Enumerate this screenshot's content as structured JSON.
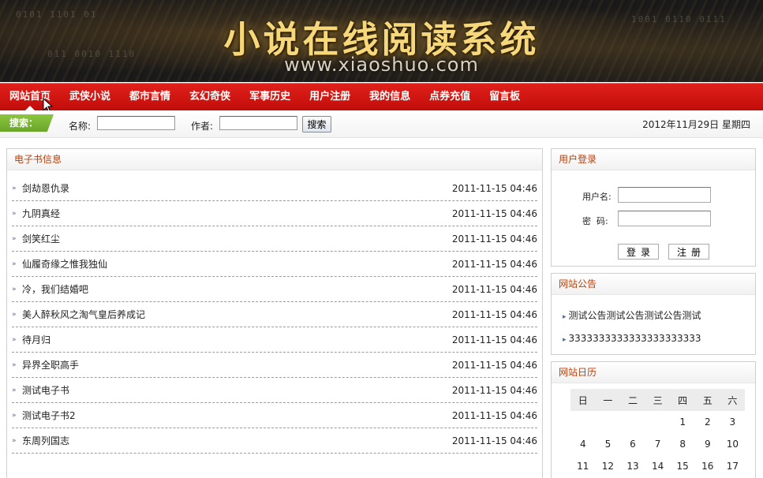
{
  "banner": {
    "title": "小说在线阅读系统",
    "url": "www.xiaoshuo.com"
  },
  "nav": {
    "items": [
      "网站首页",
      "武侠小说",
      "都市言情",
      "玄幻奇侠",
      "军事历史",
      "用户注册",
      "我的信息",
      "点券充值",
      "留言板"
    ],
    "active_index": 0
  },
  "search": {
    "tag": "搜索：",
    "name_label": "名称:",
    "name_value": "",
    "author_label": "作者:",
    "author_value": "",
    "button": "搜索"
  },
  "date": "2012年11月29日 星期四",
  "ebooks": {
    "title": "电子书信息",
    "items": [
      {
        "name": "剑劫恩仇录",
        "time": "2011-11-15 04:46"
      },
      {
        "name": "九阴真经",
        "time": "2011-11-15 04:46"
      },
      {
        "name": "剑笑红尘",
        "time": "2011-11-15 04:46"
      },
      {
        "name": "仙履奇缘之惟我独仙",
        "time": "2011-11-15 04:46"
      },
      {
        "name": "冷，我们结婚吧",
        "time": "2011-11-15 04:46"
      },
      {
        "name": "美人醉秋风之淘气皇后养成记",
        "time": "2011-11-15 04:46"
      },
      {
        "name": "待月归",
        "time": "2011-11-15 04:46"
      },
      {
        "name": "异界全职高手",
        "time": "2011-11-15 04:46"
      },
      {
        "name": "测试电子书",
        "time": "2011-11-15 04:46"
      },
      {
        "name": "测试电子书2",
        "time": "2011-11-15 04:46"
      },
      {
        "name": "东周列国志",
        "time": "2011-11-15 04:46"
      }
    ]
  },
  "login": {
    "title": "用户登录",
    "username_label": "用户名:",
    "password_label": "密  码:",
    "login_button": "登录",
    "register_button": "注册"
  },
  "notice": {
    "title": "网站公告",
    "items": [
      "测试公告测试公告测试公告测试",
      "3333333333333333333333"
    ]
  },
  "calendar": {
    "title": "网站日历",
    "weekdays": [
      "日",
      "一",
      "二",
      "三",
      "四",
      "五",
      "六"
    ],
    "rows": [
      [
        "",
        "",
        "",
        "",
        "1",
        "2",
        "3"
      ],
      [
        "4",
        "5",
        "6",
        "7",
        "8",
        "9",
        "10"
      ],
      [
        "11",
        "12",
        "13",
        "14",
        "15",
        "16",
        "17"
      ]
    ]
  },
  "colors": {
    "nav_red": "#d3150f",
    "panel_title": "#b7410e",
    "search_tag_green": "#7cb632"
  }
}
